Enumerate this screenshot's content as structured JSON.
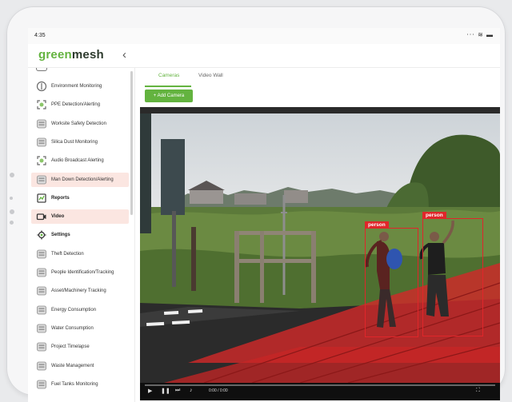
{
  "status_bar": {
    "time": "4:35",
    "icons": "⋅⋅⋅ ≋ ▬"
  },
  "app": {
    "logo_part1": "green",
    "logo_part2": "mesh",
    "collapse_icon": "chevron-left-icon"
  },
  "sidebar": {
    "items": [
      {
        "label": "Environment Monitoring",
        "icon": "leaf-icon",
        "active": false,
        "bold": false
      },
      {
        "label": "PPE Detection/Alerting",
        "icon": "scan-icon",
        "active": false,
        "bold": false
      },
      {
        "label": "Worksite Safety Detection",
        "icon": "module-icon",
        "active": false,
        "bold": false
      },
      {
        "label": "Silica Dust Monitoring",
        "icon": "module-icon",
        "active": false,
        "bold": false
      },
      {
        "label": "Audio Broadcast Alerting",
        "icon": "scan-icon",
        "active": false,
        "bold": false
      },
      {
        "label": "Man Down Detection/Alerting",
        "icon": "module-icon",
        "active": true,
        "bold": false
      },
      {
        "label": "Reports",
        "icon": "reports-icon",
        "active": false,
        "bold": true
      },
      {
        "label": "Video",
        "icon": "video-icon",
        "active": true,
        "bold": true
      },
      {
        "label": "Settings",
        "icon": "gear-icon",
        "active": false,
        "bold": true
      },
      {
        "label": "Theft Detection",
        "icon": "module-icon",
        "active": false,
        "bold": false
      },
      {
        "label": "People Identification/Tracking",
        "icon": "module-icon",
        "active": false,
        "bold": false
      },
      {
        "label": "Asset/Machinery Tracking",
        "icon": "module-icon",
        "active": false,
        "bold": false
      },
      {
        "label": "Energy Consumption",
        "icon": "module-icon",
        "active": false,
        "bold": false
      },
      {
        "label": "Water Consumption",
        "icon": "module-icon",
        "active": false,
        "bold": false
      },
      {
        "label": "Project Timelapse",
        "icon": "module-icon",
        "active": false,
        "bold": false
      },
      {
        "label": "Waste Management",
        "icon": "module-icon",
        "active": false,
        "bold": false
      },
      {
        "label": "Fuel Tanks Monitoring",
        "icon": "module-icon",
        "active": false,
        "bold": false
      }
    ]
  },
  "tabs": [
    {
      "label": "Cameras",
      "active": true
    },
    {
      "label": "Video Wall",
      "active": false
    }
  ],
  "toolbar": {
    "add_camera_label": "+ Add Camera"
  },
  "video": {
    "detections": [
      {
        "label": "person"
      },
      {
        "label": "person"
      }
    ],
    "player": {
      "time": "0:00 / 0:00"
    }
  },
  "colors": {
    "brand_green": "#63b33f",
    "detection_red": "#e0262a",
    "active_item_bg": "#fbe6e1"
  }
}
